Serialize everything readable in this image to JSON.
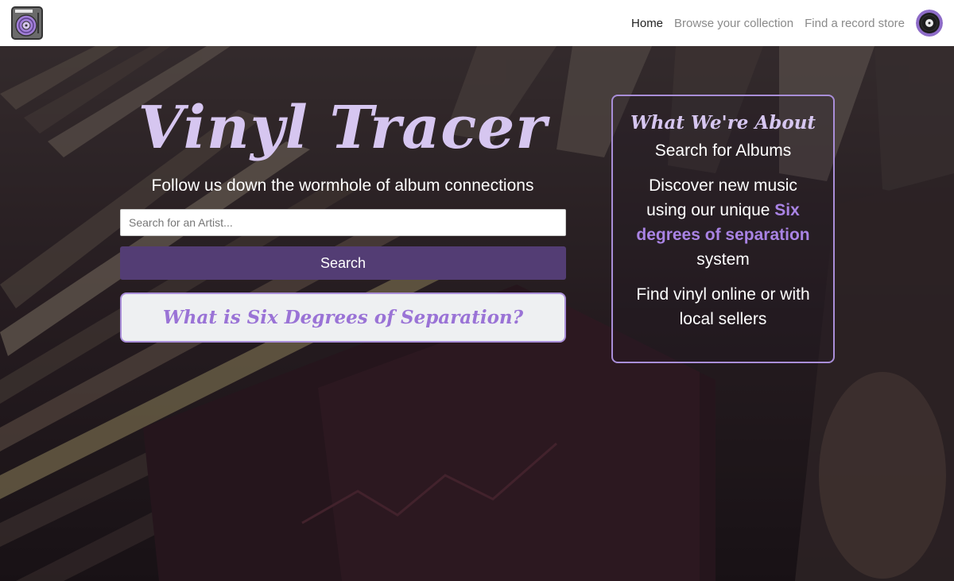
{
  "navbar": {
    "logo_icon": "turntable-icon",
    "links": [
      {
        "label": "Home",
        "active": true
      },
      {
        "label": "Browse your collection",
        "active": false
      },
      {
        "label": "Find a record store",
        "active": false
      }
    ],
    "avatar_icon": "vinyl-record-icon"
  },
  "hero": {
    "title": "Vinyl Tracer",
    "tagline": "Follow us down the wormhole of album connections",
    "search": {
      "placeholder": "Search for an Artist...",
      "value": "",
      "button_label": "Search"
    },
    "six_degrees_button": "What is Six Degrees of Separation?"
  },
  "about": {
    "title": "What We're About",
    "line1": "Search for Albums",
    "line2_pre": "Discover new music using our unique ",
    "line2_highlight": "Six degrees of separation",
    "line2_post": " system",
    "line3": "Find vinyl online or with local sellers"
  },
  "colors": {
    "accent": "#533d74",
    "lavender": "#d6c6f0",
    "highlight": "#a983e4",
    "border": "#a98ed8"
  }
}
